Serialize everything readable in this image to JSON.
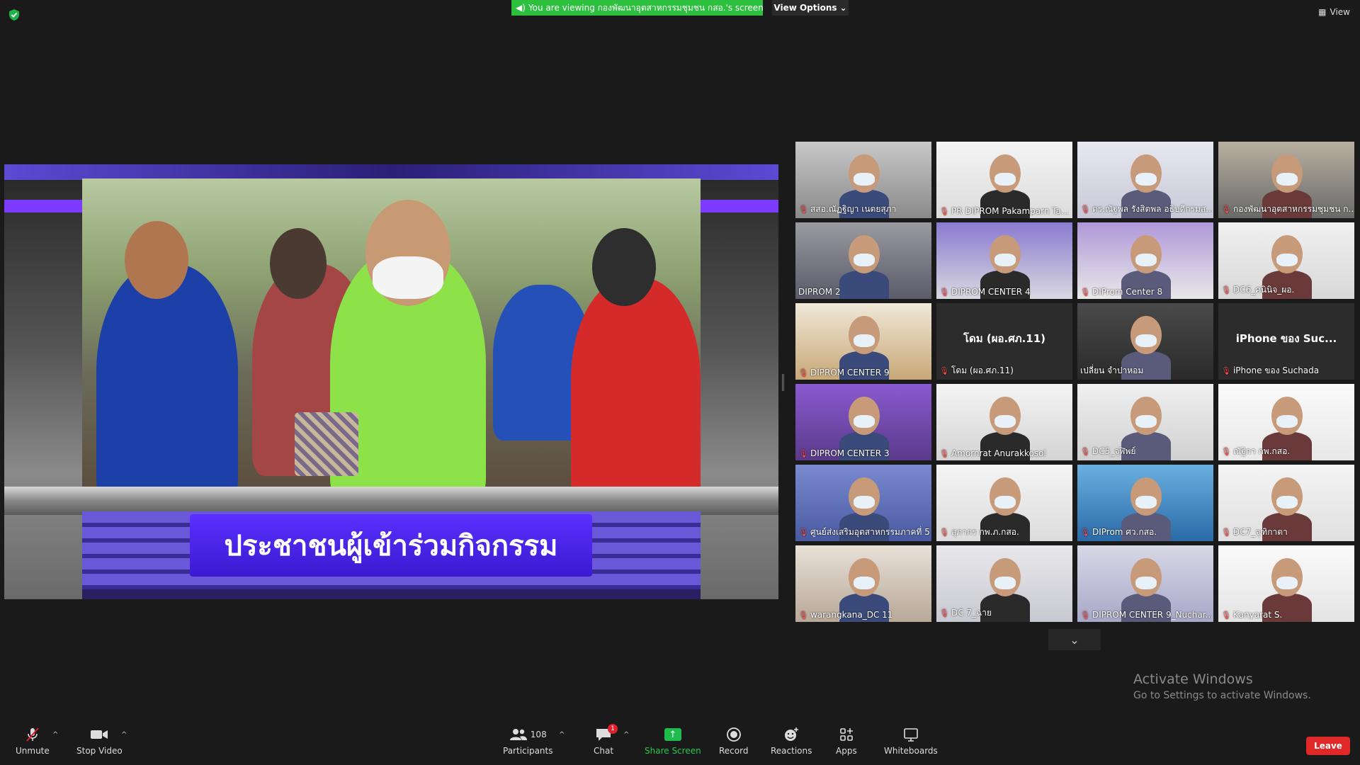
{
  "banner": {
    "text": "You are viewing กองพัฒนาอุตสาหกรรมชุมชน กสอ.'s screen",
    "view_options_label": "View Options",
    "view_label": "View"
  },
  "shared_screen": {
    "caption": "ประชาชนผู้เข้าร่วมกิจกรรม"
  },
  "gallery": {
    "tiles": [
      {
        "name": "สสอ.ณัฏฐิญา เนตยสุภา",
        "muted": true
      },
      {
        "name": "PR DIPROM Pakamparn Ta...",
        "muted": true
      },
      {
        "name": "ดร.ณัฐพล รังสิตพล อธิบดีกรมส...",
        "muted": true
      },
      {
        "name": "กองพัฒนาอุตสาหกรรมชุมชน ก...",
        "muted": true
      },
      {
        "name": "DIPROM 2",
        "muted": false
      },
      {
        "name": "DIPROM CENTER 4",
        "muted": true
      },
      {
        "name": "DIProm Center 8",
        "muted": true
      },
      {
        "name": "DC6_ศนินิจ_ผอ.",
        "muted": true
      },
      {
        "name": "DIPROM CENTER 9",
        "muted": true
      },
      {
        "name": "โดม (ผอ.ศภ.11)",
        "muted": true,
        "big_name": "โดม (ผอ.ศภ.11)"
      },
      {
        "name": "เปลี่ยน จำปาหอม",
        "muted": false,
        "active": true
      },
      {
        "name": "iPhone ของ Suchada",
        "muted": true,
        "big_name": "iPhone ของ Suc..."
      },
      {
        "name": "DIPROM CENTER 3",
        "muted": true
      },
      {
        "name": "Amornrat Anurakkosol",
        "muted": true
      },
      {
        "name": "DC5_จุฬิพย์",
        "muted": true
      },
      {
        "name": "ณัฐิกา กพ.กสอ.",
        "muted": true
      },
      {
        "name": "ศูนย์ส่งเสริมอุตสาหกรรมภาคที่ 5...",
        "muted": true
      },
      {
        "name": "สุภากร กพ.ภ.กสอ.",
        "muted": true
      },
      {
        "name": "DIProm ศว.กสอ.",
        "muted": true
      },
      {
        "name": "DC7_จุฑิกาตา",
        "muted": true
      },
      {
        "name": "warangkana_DC 11",
        "muted": true
      },
      {
        "name": "DC 7_ฉาย",
        "muted": true
      },
      {
        "name": "DIPROM CENTER 9_Nuchar...",
        "muted": true
      },
      {
        "name": "Kanyarat S.",
        "muted": true
      }
    ]
  },
  "watermark": {
    "title": "Activate Windows",
    "subtitle": "Go to Settings to activate Windows."
  },
  "toolbar": {
    "unmute": "Unmute",
    "stop_video": "Stop Video",
    "participants": "Participants",
    "participants_count": "108",
    "chat": "Chat",
    "chat_badge": "1",
    "share_screen": "Share Screen",
    "record": "Record",
    "reactions": "Reactions",
    "apps": "Apps",
    "whiteboards": "Whiteboards",
    "leave": "Leave"
  },
  "colors": {
    "share_green": "#2dbf3e",
    "leave_red": "#e02828",
    "active_speaker": "#c5e35a",
    "caption_purple": "#4a24ff"
  }
}
